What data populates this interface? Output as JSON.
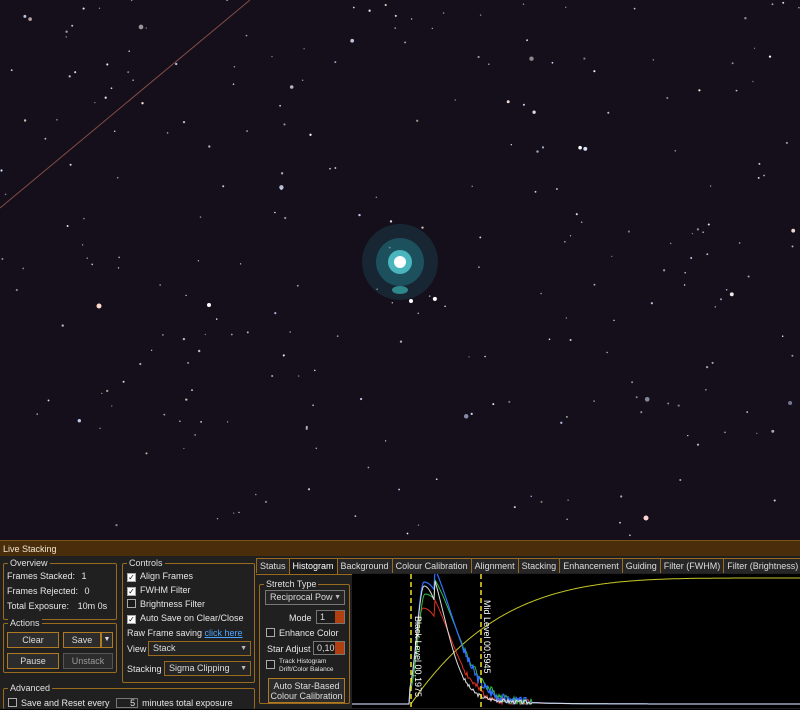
{
  "title_bar": "Live Stacking",
  "overview": {
    "title": "Overview",
    "frames_stacked_label": "Frames Stacked:",
    "frames_stacked_value": "1",
    "frames_rejected_label": "Frames Rejected:",
    "frames_rejected_value": "0",
    "total_exposure_label": "Total Exposure:",
    "total_exposure_value": "10m 0s"
  },
  "actions": {
    "title": "Actions",
    "clear": "Clear",
    "save": "Save",
    "pause": "Pause",
    "unstack": "Unstack"
  },
  "advanced": {
    "title": "Advanced",
    "save_reset_label": "Save and Reset every",
    "save_reset_value": "5",
    "save_reset_suffix": "minutes total exposure"
  },
  "controls": {
    "title": "Controls",
    "align_frames": "Align Frames",
    "align_frames_checked": true,
    "fwhm_filter": "FWHM Filter",
    "fwhm_filter_checked": true,
    "brightness_filter": "Brightness Filter",
    "brightness_filter_checked": false,
    "auto_save": "Auto Save on Clear/Close",
    "auto_save_checked": true,
    "raw_frame_label": "Raw Frame saving",
    "raw_frame_link": "click here",
    "view_label": "View",
    "view_value": "Stack",
    "stacking_label": "Stacking",
    "stacking_value": "Sigma Clipping"
  },
  "tabs": [
    "Status",
    "Histogram",
    "Background",
    "Colour Calibration",
    "Alignment",
    "Stacking",
    "Enhancement",
    "Guiding",
    "Filter (FWHM)",
    "Filter (Brightness)"
  ],
  "active_tab": "Histogram",
  "stretch": {
    "title": "Stretch Type",
    "type_value": "Reciprocal Pow",
    "mode_label": "Mode",
    "mode_value": "1",
    "enhance_color": "Enhance Color",
    "star_adjust_label": "Star Adjust",
    "star_adjust_value": "0,10",
    "track_histogram": "Track Histogram Drift/Color Balance",
    "auto_calibration_line1": "Auto Star-Based",
    "auto_calibration_line2": "Colour Calibration"
  },
  "histogram": {
    "black_level_label": "Black Level 00,1975",
    "mid_level_label": "Mid Level 00,5945",
    "black_level": 0.1975,
    "mid_level": 0.5945
  },
  "colors": {
    "accent": "#9a6a1e",
    "titlebar": "#4a2e0c",
    "level_marker": "#f0e020",
    "curve": "#c8c828"
  }
}
